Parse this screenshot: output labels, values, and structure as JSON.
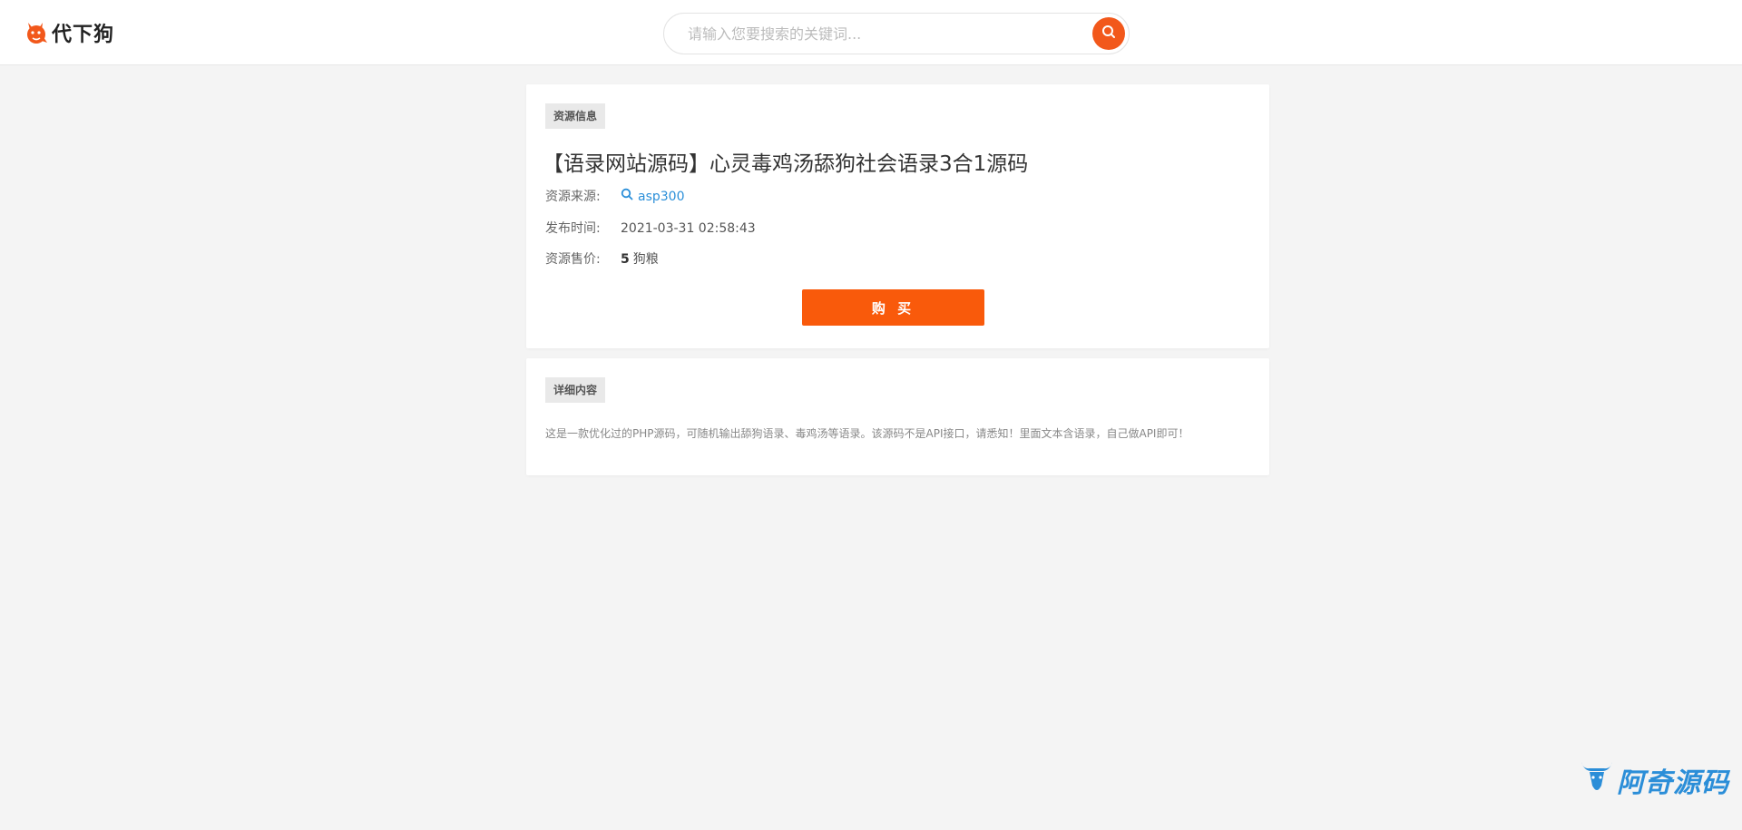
{
  "header": {
    "logo_text": "代下狗",
    "logo_icon": "dog-logo-icon",
    "search_placeholder": "请输入您要搜索的关键词...",
    "search_icon": "search-icon",
    "accent_color": "#f2581b"
  },
  "resource": {
    "section_tag": "资源信息",
    "title": "【语录网站源码】心灵毒鸡汤舔狗社会语录3合1源码",
    "source_label": "资源来源:",
    "source_value": "asp300",
    "time_label": "发布时间:",
    "time_value": "2021-03-31 02:58:43",
    "price_label": "资源售价:",
    "price_value": "5",
    "price_unit": "狗粮",
    "buy_label": "购 买",
    "buy_color": "#f95a0b"
  },
  "detail": {
    "section_tag": "详细内容",
    "description": "这是一款优化过的PHP源码，可随机输出舔狗语录、毒鸡汤等语录。该源码不是API接口，请悉知！里面文本含语录，自己做API即可！"
  },
  "watermark": {
    "text": "阿奇源码",
    "icon": "bull-logo-icon",
    "color": "#2b8ed8"
  }
}
